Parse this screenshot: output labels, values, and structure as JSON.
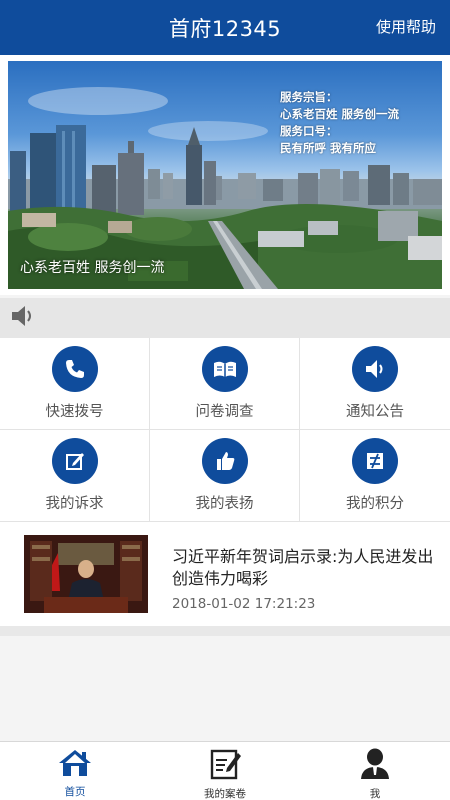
{
  "header": {
    "title": "首府12345",
    "help_label": "使用帮助"
  },
  "banner": {
    "motto_lines": [
      "服务宗旨：",
      "心系老百姓  服务创一流",
      "服务口号：",
      "民有所呼  我有所应"
    ],
    "slogan": "心系老百姓 服务创一流"
  },
  "notice": {
    "icon": "speaker-icon"
  },
  "grid": {
    "items": [
      {
        "label": "快速拨号",
        "icon": "phone-icon"
      },
      {
        "label": "问卷调查",
        "icon": "survey-icon"
      },
      {
        "label": "通知公告",
        "icon": "speaker-icon"
      },
      {
        "label": "我的诉求",
        "icon": "edit-icon"
      },
      {
        "label": "我的表扬",
        "icon": "thumbs-up-icon"
      },
      {
        "label": "我的积分",
        "icon": "points-icon"
      }
    ],
    "accent": "#0f4c9c"
  },
  "news": {
    "headline": "习近平新年贺词启示录:为人民进发出创造伟力喝彩",
    "time": "2018-01-02 17:21:23"
  },
  "tabbar": {
    "tabs": [
      {
        "label": "首页",
        "icon": "home-icon",
        "active": true
      },
      {
        "label": "我的案卷",
        "icon": "case-file-icon",
        "active": false
      },
      {
        "label": "我",
        "icon": "user-icon",
        "active": false
      }
    ]
  },
  "colors": {
    "primary": "#0f4c9c",
    "background": "#f4f4f4"
  }
}
